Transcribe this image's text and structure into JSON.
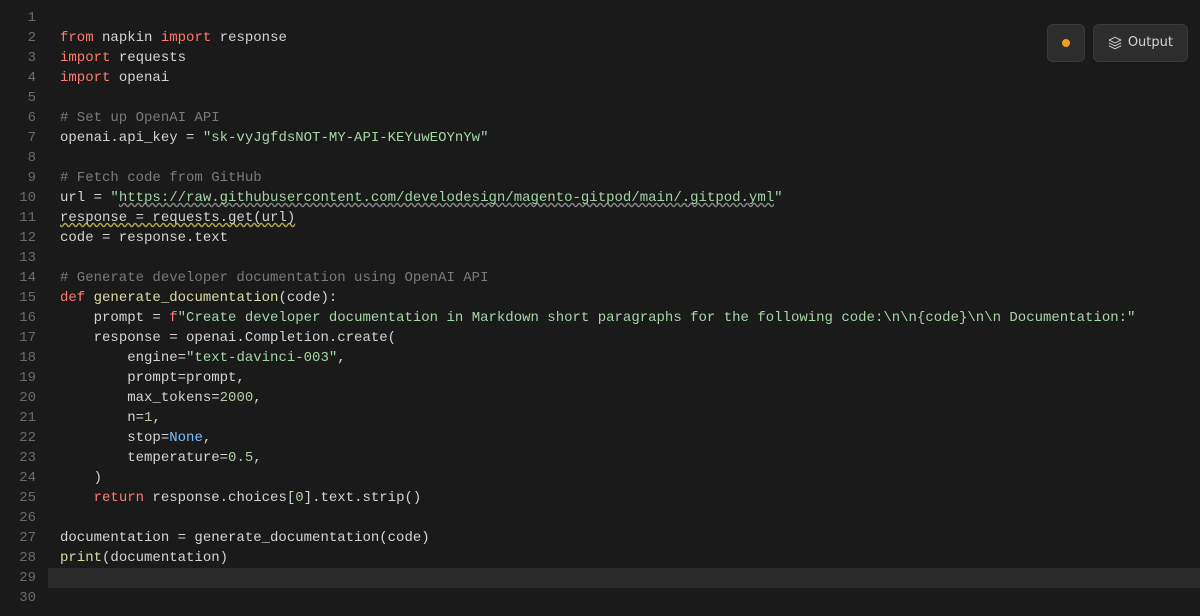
{
  "buttons": {
    "output_label": "Output"
  },
  "code_lines": [
    {
      "n": 1,
      "segments": []
    },
    {
      "n": 2,
      "segments": [
        {
          "t": "from",
          "c": "kw"
        },
        {
          "t": " ",
          "c": ""
        },
        {
          "t": "napkin",
          "c": "mod"
        },
        {
          "t": " ",
          "c": ""
        },
        {
          "t": "import",
          "c": "kw"
        },
        {
          "t": " ",
          "c": ""
        },
        {
          "t": "response",
          "c": "var"
        }
      ]
    },
    {
      "n": 3,
      "segments": [
        {
          "t": "import",
          "c": "kw"
        },
        {
          "t": " ",
          "c": ""
        },
        {
          "t": "requests",
          "c": "mod"
        }
      ]
    },
    {
      "n": 4,
      "segments": [
        {
          "t": "import",
          "c": "kw"
        },
        {
          "t": " ",
          "c": ""
        },
        {
          "t": "openai",
          "c": "mod"
        }
      ]
    },
    {
      "n": 5,
      "segments": []
    },
    {
      "n": 6,
      "segments": [
        {
          "t": "# Set up OpenAI API",
          "c": "cmt"
        }
      ]
    },
    {
      "n": 7,
      "segments": [
        {
          "t": "openai.api_key = ",
          "c": "var"
        },
        {
          "t": "\"sk-vyJgfdsNOT-MY-API-KEYuwEOYnYw\"",
          "c": "str"
        }
      ]
    },
    {
      "n": 8,
      "segments": []
    },
    {
      "n": 9,
      "segments": [
        {
          "t": "# Fetch code from GitHub",
          "c": "cmt"
        }
      ]
    },
    {
      "n": 10,
      "segments": [
        {
          "t": "url = ",
          "c": "var"
        },
        {
          "t": "\"",
          "c": "str"
        },
        {
          "t": "https://raw.githubusercontent.com/develodesign/magento-gitpod/main/.gitpod.yml",
          "c": "str underline-wavy"
        },
        {
          "t": "\"",
          "c": "str"
        }
      ]
    },
    {
      "n": 11,
      "segments": [
        {
          "t": "response = requests.get(url)",
          "c": "var underline-wavy-y"
        }
      ]
    },
    {
      "n": 12,
      "segments": [
        {
          "t": "code = response.text",
          "c": "var"
        }
      ]
    },
    {
      "n": 13,
      "segments": []
    },
    {
      "n": 14,
      "segments": [
        {
          "t": "# Generate developer documentation using OpenAI API",
          "c": "cmt"
        }
      ]
    },
    {
      "n": 15,
      "segments": [
        {
          "t": "def",
          "c": "kw"
        },
        {
          "t": " ",
          "c": ""
        },
        {
          "t": "generate_documentation",
          "c": "fn"
        },
        {
          "t": "(code):",
          "c": "var"
        }
      ]
    },
    {
      "n": 16,
      "indent": 1,
      "segments": [
        {
          "t": "prompt = ",
          "c": "var"
        },
        {
          "t": "f",
          "c": "kw"
        },
        {
          "t": "\"Create developer documentation in Markdown short paragraphs for the following code:\\n\\n",
          "c": "str"
        },
        {
          "t": "{code}",
          "c": "str"
        },
        {
          "t": "\\n\\n Documentation:\"",
          "c": "str"
        }
      ]
    },
    {
      "n": 17,
      "indent": 1,
      "segments": [
        {
          "t": "response = openai.Completion.create(",
          "c": "var"
        }
      ]
    },
    {
      "n": 18,
      "indent": 2,
      "segments": [
        {
          "t": "engine=",
          "c": "var"
        },
        {
          "t": "\"text-davinci-003\"",
          "c": "str"
        },
        {
          "t": ",",
          "c": "var"
        }
      ]
    },
    {
      "n": 19,
      "indent": 2,
      "segments": [
        {
          "t": "prompt=prompt,",
          "c": "var"
        }
      ]
    },
    {
      "n": 20,
      "indent": 2,
      "segments": [
        {
          "t": "max_tokens=",
          "c": "var"
        },
        {
          "t": "2000",
          "c": "num"
        },
        {
          "t": ",",
          "c": "var"
        }
      ]
    },
    {
      "n": 21,
      "indent": 2,
      "segments": [
        {
          "t": "n=",
          "c": "var"
        },
        {
          "t": "1",
          "c": "num"
        },
        {
          "t": ",",
          "c": "var"
        }
      ]
    },
    {
      "n": 22,
      "indent": 2,
      "segments": [
        {
          "t": "stop=",
          "c": "var"
        },
        {
          "t": "None",
          "c": "const"
        },
        {
          "t": ",",
          "c": "var"
        }
      ]
    },
    {
      "n": 23,
      "indent": 2,
      "segments": [
        {
          "t": "temperature=",
          "c": "var"
        },
        {
          "t": "0.5",
          "c": "num"
        },
        {
          "t": ",",
          "c": "var"
        }
      ]
    },
    {
      "n": 24,
      "indent": 1,
      "segments": [
        {
          "t": ")",
          "c": "var"
        }
      ]
    },
    {
      "n": 25,
      "indent": 1,
      "segments": [
        {
          "t": "return",
          "c": "kw"
        },
        {
          "t": " response.choices[",
          "c": "var"
        },
        {
          "t": "0",
          "c": "num"
        },
        {
          "t": "].text.strip()",
          "c": "var"
        }
      ]
    },
    {
      "n": 26,
      "segments": []
    },
    {
      "n": 27,
      "segments": [
        {
          "t": "documentation = generate_documentation(code)",
          "c": "var"
        }
      ]
    },
    {
      "n": 28,
      "segments": [
        {
          "t": "print",
          "c": "fn"
        },
        {
          "t": "(documentation)",
          "c": "var"
        }
      ]
    },
    {
      "n": 29,
      "hl": true,
      "segments": []
    },
    {
      "n": 30,
      "segments": []
    }
  ]
}
